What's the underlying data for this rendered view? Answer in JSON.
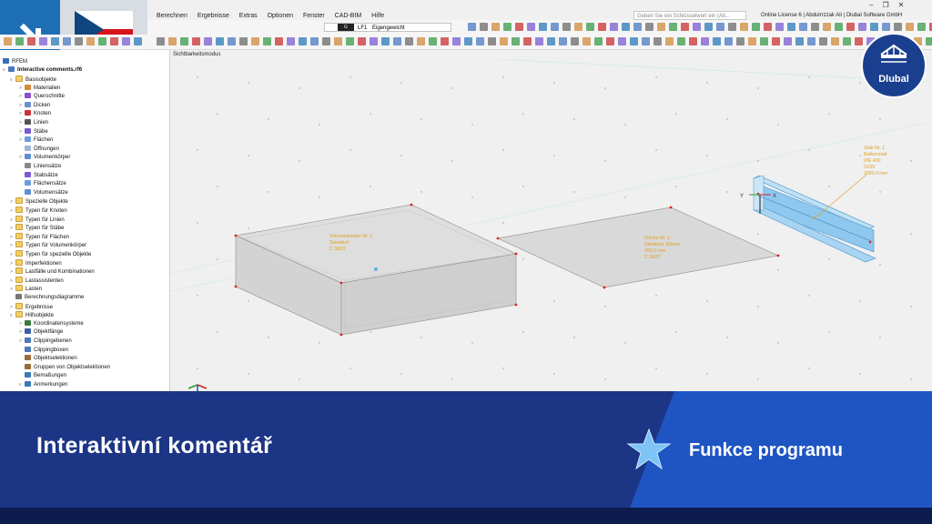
{
  "menubar": {
    "items": [
      "Berechnen",
      "Ergebnisse",
      "Extras",
      "Optionen",
      "Fenster",
      "CAD-BIM",
      "Hilfe"
    ],
    "search_placeholder": "Geben Sie ein Schlüsselwort ein (Alt...",
    "license": "Online License 6 | Abdulrrzzak Ali | Dlubal Software GmbH"
  },
  "toolbar": {
    "load_case_badge": "G",
    "load_case_id": "LF1",
    "load_case_name": "Eigengewicht"
  },
  "navigator": {
    "title": "RFEM",
    "file": "Interactive comments.rf6",
    "items": [
      {
        "label": "Basisobjekte",
        "level": 1,
        "exp": "v",
        "icon": "folder-icon",
        "color": "#f2cf63"
      },
      {
        "label": "Materialien",
        "level": 2,
        "exp": ">",
        "icon": "material-icon",
        "color": "#d08a3a"
      },
      {
        "label": "Querschnitte",
        "level": 2,
        "exp": ">",
        "icon": "cross-section-icon",
        "color": "#8a4fc9"
      },
      {
        "label": "Dicken",
        "level": 2,
        "exp": ">",
        "icon": "thickness-icon",
        "color": "#6b8fc9"
      },
      {
        "label": "Knoten",
        "level": 2,
        "exp": ">",
        "icon": "node-icon",
        "color": "#c83232"
      },
      {
        "label": "Linien",
        "level": 2,
        "exp": ">",
        "icon": "line-icon",
        "color": "#555555"
      },
      {
        "label": "Stäbe",
        "level": 2,
        "exp": ">",
        "icon": "member-icon",
        "color": "#7a5bd0"
      },
      {
        "label": "Flächen",
        "level": 2,
        "exp": ">",
        "icon": "surface-icon",
        "color": "#6a9fd8"
      },
      {
        "label": "Öffnungen",
        "level": 2,
        "exp": "",
        "icon": "opening-icon",
        "color": "#9fb7d8"
      },
      {
        "label": "Volumenkörper",
        "level": 2,
        "exp": ">",
        "icon": "solid-icon",
        "color": "#5f8fd0"
      },
      {
        "label": "Liniensätze",
        "level": 2,
        "exp": "",
        "icon": "line-set-icon",
        "color": "#888888"
      },
      {
        "label": "Stabsätze",
        "level": 2,
        "exp": "",
        "icon": "member-set-icon",
        "color": "#7a5bd0"
      },
      {
        "label": "Flächensätze",
        "level": 2,
        "exp": "",
        "icon": "surface-set-icon",
        "color": "#6a9fd8"
      },
      {
        "label": "Volumensätze",
        "level": 2,
        "exp": "",
        "icon": "solid-set-icon",
        "color": "#5f8fd0"
      },
      {
        "label": "Spezielle Objekte",
        "level": 1,
        "exp": ">",
        "icon": "folder-icon",
        "color": "#f2cf63"
      },
      {
        "label": "Typen für Knoten",
        "level": 1,
        "exp": ">",
        "icon": "folder-icon",
        "color": "#f2cf63"
      },
      {
        "label": "Typen für Linien",
        "level": 1,
        "exp": ">",
        "icon": "folder-icon",
        "color": "#f2cf63"
      },
      {
        "label": "Typen für Stäbe",
        "level": 1,
        "exp": ">",
        "icon": "folder-icon",
        "color": "#f2cf63"
      },
      {
        "label": "Typen für Flächen",
        "level": 1,
        "exp": ">",
        "icon": "folder-icon",
        "color": "#f2cf63"
      },
      {
        "label": "Typen für Volumenkörper",
        "level": 1,
        "exp": ">",
        "icon": "folder-icon",
        "color": "#f2cf63"
      },
      {
        "label": "Typen für spezielle Objekte",
        "level": 1,
        "exp": ">",
        "icon": "folder-icon",
        "color": "#f2cf63"
      },
      {
        "label": "Imperfektionen",
        "level": 1,
        "exp": ">",
        "icon": "folder-icon",
        "color": "#f2cf63"
      },
      {
        "label": "Lastfälle und Kombinationen",
        "level": 1,
        "exp": ">",
        "icon": "folder-icon",
        "color": "#f2cf63"
      },
      {
        "label": "Lastassistenten",
        "level": 1,
        "exp": ">",
        "icon": "folder-icon",
        "color": "#f2cf63"
      },
      {
        "label": "Lasten",
        "level": 1,
        "exp": ">",
        "icon": "folder-icon",
        "color": "#f2cf63"
      },
      {
        "label": "Berechnungsdiagramme",
        "level": 1,
        "exp": "",
        "icon": "diagram-icon",
        "color": "#777777"
      },
      {
        "label": "Ergebnisse",
        "level": 1,
        "exp": ">",
        "icon": "folder-icon",
        "color": "#f2cf63"
      },
      {
        "label": "Hilfsobjekte",
        "level": 1,
        "exp": "v",
        "icon": "folder-icon",
        "color": "#f2cf63"
      },
      {
        "label": "Koordinatensysteme",
        "level": 2,
        "exp": ">",
        "icon": "coordinate-system-icon",
        "color": "#3a7a3a"
      },
      {
        "label": "Objektfänge",
        "level": 2,
        "exp": ">",
        "icon": "snap-icon",
        "color": "#3a5fa8"
      },
      {
        "label": "Clippingebenen",
        "level": 2,
        "exp": ">",
        "icon": "clipping-plane-icon",
        "color": "#4a7ab8"
      },
      {
        "label": "Clippingboxen",
        "level": 2,
        "exp": "",
        "icon": "clipping-box-icon",
        "color": "#4a7ab8"
      },
      {
        "label": "Objektselektionen",
        "level": 2,
        "exp": "",
        "icon": "selection-icon",
        "color": "#9a6a3a"
      },
      {
        "label": "Gruppen von Objektselektionen",
        "level": 2,
        "exp": "",
        "icon": "selection-group-icon",
        "color": "#9a6a3a"
      },
      {
        "label": "Bemaßungen",
        "level": 2,
        "exp": "",
        "icon": "dimension-icon",
        "color": "#3a7ab8"
      },
      {
        "label": "Anmerkungen",
        "level": 2,
        "exp": "v",
        "icon": "note-icon",
        "color": "#3a7ab8"
      }
    ]
  },
  "viewport": {
    "mode_label": "Sichtbarkeitsmodus",
    "solid_comment": [
      "Volumenkörper Nr. 1",
      "Standard",
      "C 30/37"
    ],
    "surface_comment": [
      "Fläche Nr. 1",
      "Standard, Ebene",
      "300.0 mm",
      "C 30/37"
    ],
    "member_comment": [
      "Stab Nr. 1",
      "Balkenstab",
      "IPE 400",
      "S235",
      "3000.0 mm"
    ],
    "axis_x": "X",
    "axis_y": "Y",
    "comment_color": "#e0a020"
  },
  "logo": {
    "text": "Dlubal"
  },
  "banner": {
    "title": "Interaktivní komentář",
    "feature_label": "Funkce programu",
    "colors": {
      "primary": "#1c3585",
      "accent": "#1f55c3",
      "dark": "#0c1c4e"
    }
  }
}
